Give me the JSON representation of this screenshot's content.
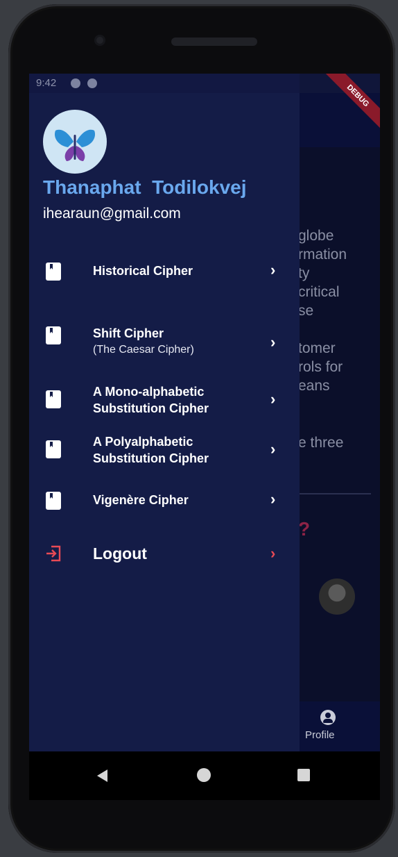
{
  "status": {
    "time": "9:42"
  },
  "debug_banner": "DEBUG",
  "drawer": {
    "user": {
      "name": "Thanaphat  Todilokvej",
      "email": "ihearaun@gmail.com"
    },
    "menu": [
      {
        "label": "Historical Cipher",
        "sub": ""
      },
      {
        "label": "Shift Cipher",
        "sub": "(The Caesar Cipher)"
      },
      {
        "label": "A Mono-alphabetic",
        "label2": "Substitution Cipher"
      },
      {
        "label": "A Polyalphabetic",
        "label2": "Substitution Cipher"
      },
      {
        "label": "Vigenère Cipher",
        "sub": ""
      }
    ],
    "logout_label": "Logout"
  },
  "background": {
    "text_lines": [
      "globe",
      "rmation",
      "ty",
      "critical",
      "se",
      "tomer",
      "rols for",
      "eans",
      "e three"
    ],
    "question_mark": "?",
    "bottom_nav": {
      "profile_label": "Profile"
    }
  },
  "colors": {
    "drawer_bg": "#141c47",
    "name_accent": "#6aa8ee",
    "logout_accent": "#e84a55"
  }
}
